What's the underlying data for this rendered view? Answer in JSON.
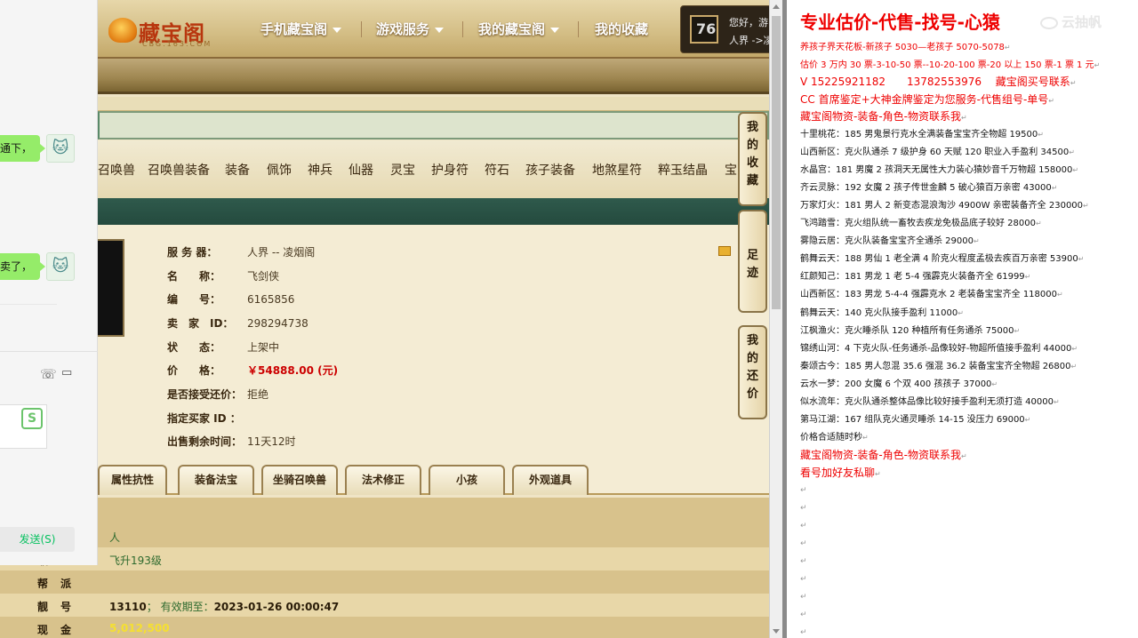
{
  "site": {
    "logo_text": "藏宝阁",
    "logo_sub": "CBG.163.COM",
    "nav": [
      "手机藏宝阁",
      "游戏服务",
      "我的藏宝阁",
      "我的收藏"
    ],
    "user_greeting": "您好，游",
    "user_server": "人界 ->凌",
    "categories": [
      "召唤兽",
      "召唤兽装备",
      "装备",
      "佩饰",
      "神兵",
      "仙器",
      "灵宝",
      "护身符",
      "符石",
      "孩子装备",
      "地煞星符",
      "粹玉结晶",
      "宝"
    ],
    "detail": {
      "server_label": "服 务 器：",
      "server_value": "人界 -- 凌烟阁",
      "name_label": "名　　称：",
      "name_value": "飞剑侠",
      "id_label": "编　　号：",
      "id_value": "6165856",
      "seller_label": "卖　家　ID：",
      "seller_value": "298294738",
      "status_label": "状　　态：",
      "status_value": "上架中",
      "price_label": "价　　格：",
      "price_value": "￥54888.00 (元)",
      "counter_label": "是否接受还价：",
      "counter_value": "拒绝",
      "buyer_label": "指定买家 ID ：",
      "buyer_value": "",
      "remain_label": "出售剩余时间：",
      "remain_value": "11天12时"
    },
    "tabs": [
      "属性抗性",
      "装备法宝",
      "坐骑召唤兽",
      "法术修正",
      "小孩",
      "外观道具"
    ],
    "side_buttons": [
      "我的收藏",
      "足迹",
      "我的还价"
    ],
    "info_rows": [
      {
        "k": "",
        "v": "人"
      },
      {
        "k": "级",
        "v": "飞升193级"
      },
      {
        "k": "帮派",
        "v": ""
      },
      {
        "k": "靓号",
        "v": "13110",
        "v2": "； 有效期至：",
        "v3": "2023-01-26 00:00:47"
      },
      {
        "k": "现金",
        "v": "5,012,500"
      }
    ]
  },
  "chat": {
    "msg1": "通下，",
    "msg2": "卖了，",
    "avatar_glyph": "🐱",
    "send_label": "发送(S)",
    "ime_glyph": "S",
    "phone_icon": "☏",
    "video_icon": "▭"
  },
  "doc": {
    "title": "专业估价-代售-找号-心猿",
    "lines": [
      {
        "t": "养孩子界天花板-新孩子 5030—老孩子 5070-5078",
        "red": true
      },
      {
        "t": "估价 3 万内 30 票-3-10-50 票--10-20-100 票-20 以上 150 票-1 票 1 元",
        "red": true
      },
      {
        "t": "V 15225921182　　13782553976　 藏宝阁买号联系",
        "red": true,
        "big": true
      },
      {
        "t": "CC 首席鉴定+大神金牌鉴定为您服务-代售组号-单号",
        "red": true,
        "big": true
      },
      {
        "t": "藏宝阁物资-装备-角色-物资联系我",
        "red": true,
        "big": true
      },
      {
        "t": "十里桃花：185 男鬼景行克水全满装备宝宝齐全物超 19500"
      },
      {
        "t": "山西新区：克火队通杀 7 级护身 60 天赋 120 职业入手盈利 34500"
      },
      {
        "t": "水晶宫：181 男魔 2 孩洞天无属性大力装心猿妙音千万物超 158000"
      },
      {
        "t": "齐云灵脉：192 女魔 2 孩子传世金麟 5 破心猿百万亲密 43000"
      },
      {
        "t": "万家灯火：181 男人 2 新变态混浪淘沙 4900W 亲密装备齐全 230000"
      },
      {
        "t": "飞鸿踏雪：克火组队统一畜牧去疾龙免极品底子较好 28000"
      },
      {
        "t": "雾隐云居：克火队装备宝宝齐全通杀 29000"
      },
      {
        "t": "鹤舞云天：188 男仙 1 老全满 4 阶克火程度孟极去疾百万亲密 53900"
      },
      {
        "t": "红颜知己：181 男龙 1 老 5-4 强霹克火装备齐全 61999"
      },
      {
        "t": "山西新区：183 男龙 5-4-4 强霹克水 2 老装备宝宝齐全 118000"
      },
      {
        "t": "鹤舞云天：140 克火队接手盈利 11000"
      },
      {
        "t": "江枫渔火：克火睡杀队 120 种植所有任务通杀 75000"
      },
      {
        "t": "锦绣山河：4 下克火队-任务通杀-品像较好-物超所值接手盈利 44000"
      },
      {
        "t": "秦颂古今：185 男人忽混 35.6 强混 36.2 装备宝宝齐全物超 26800"
      },
      {
        "t": "云水一梦：200 女魔 6 个双 400 孩孩子 37000"
      },
      {
        "t": "似水流年：克火队通杀整体品像比较好接手盈利无须打造 40000"
      },
      {
        "t": "第马江湖：167 组队克火通灵睡杀 14-15 没压力 69000"
      },
      {
        "t": "价格合适随时秒"
      },
      {
        "t": "藏宝阁物资-装备-角色-物资联系我",
        "red": true,
        "big": true
      },
      {
        "t": "看号加好友私聊",
        "red": true,
        "big": true
      }
    ],
    "para_mark": "↵",
    "watermark": "云抽帆"
  }
}
